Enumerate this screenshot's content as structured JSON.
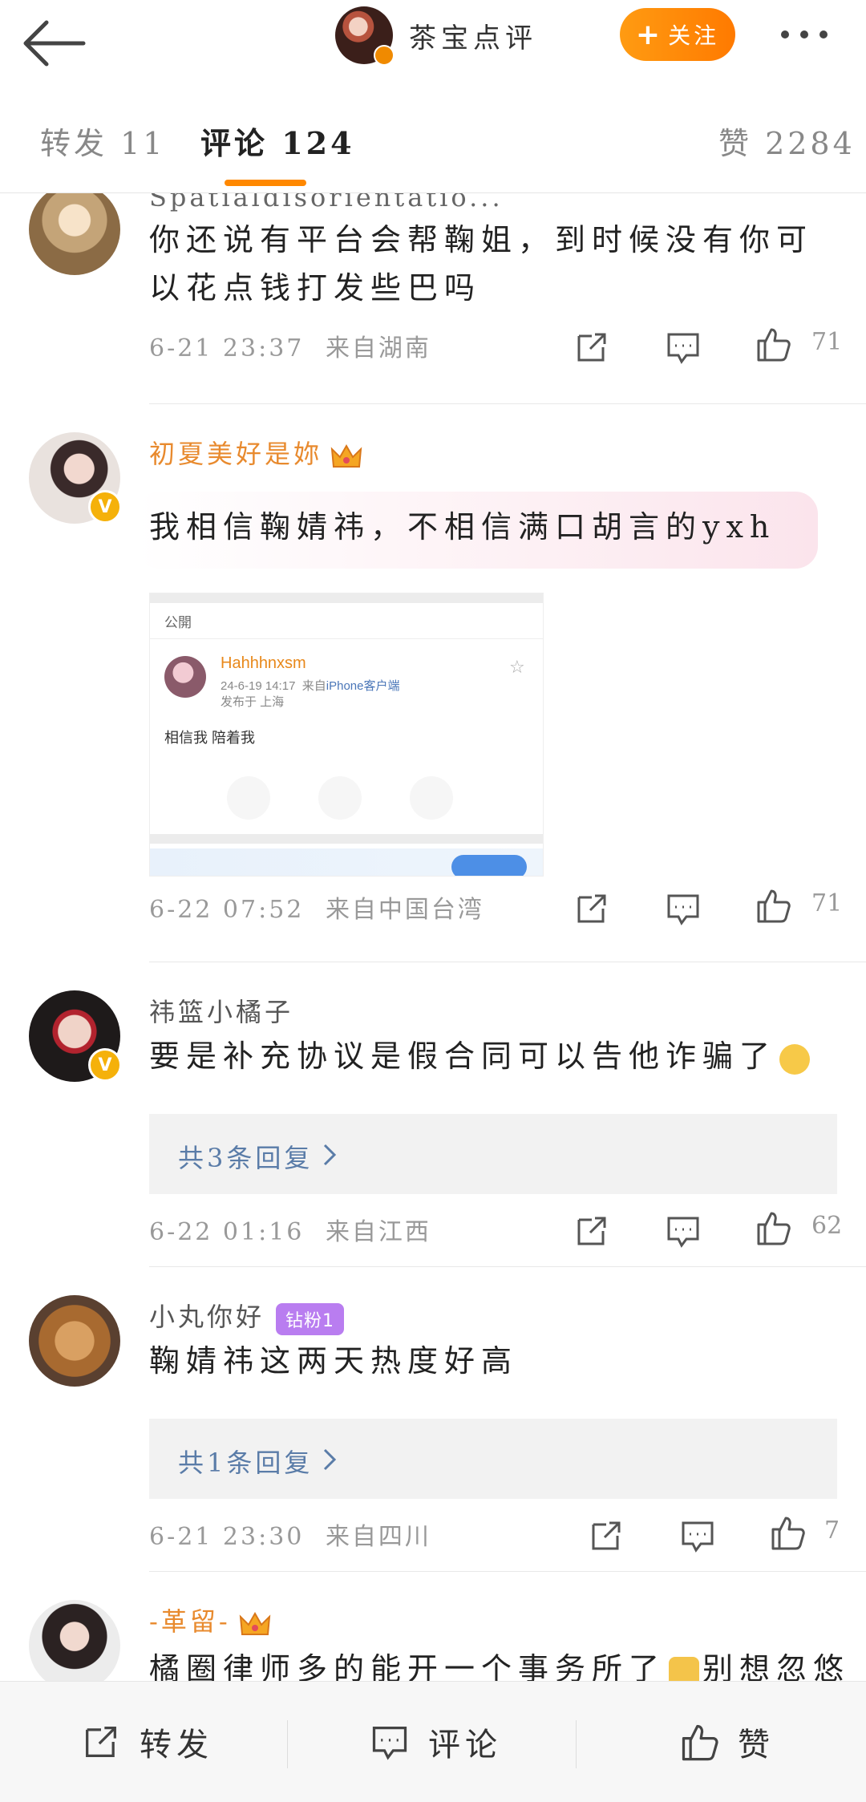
{
  "header": {
    "title": "茶宝点评",
    "follow_label": "关注"
  },
  "tabs": [
    {
      "label": "转发 11"
    },
    {
      "label": "评论 124"
    },
    {
      "label": "赞 2284"
    }
  ],
  "comments": [
    {
      "username": "Spatialdisorientatio...",
      "text": "你还说有平台会帮鞠姐，到时候没有你可以花点钱打发些巴吗",
      "time": "6-21 23:37",
      "location": "来自湖南",
      "likes": "71"
    },
    {
      "username": "初夏美好是妳",
      "text": "我相信鞠婧祎，不相信满口胡言的yxh",
      "time": "6-22 07:52",
      "location": "来自中国台湾",
      "likes": "71",
      "screenshot": {
        "visibility": "公開",
        "name": "Hahhhnxsm",
        "date": "24-6-19 14:17",
        "via_prefix": "来自",
        "via": "iPhone客户端",
        "published": "发布于 上海",
        "body": "相信我 陪着我"
      }
    },
    {
      "username": "祎篮小橘子",
      "text": "要是补充协议是假合同可以告他诈骗了",
      "replies": "共3条回复",
      "time": "6-22 01:16",
      "location": "来自江西",
      "likes": "62"
    },
    {
      "username": "小丸你好",
      "badge": "钻粉1",
      "text": "鞠婧祎这两天热度好高",
      "replies": "共1条回复",
      "time": "6-21 23:30",
      "location": "来自四川",
      "likes": "7"
    },
    {
      "username": "-革留-",
      "text": "橘圈律师多的能开一个事务所了",
      "text_tail": "别想忽悠"
    }
  ],
  "bottom_bar": {
    "repost": "转发",
    "comment": "评论",
    "like": "赞"
  },
  "colors": {
    "accent": "#ff8800",
    "reply_link": "#5a7ca8",
    "vip_name": "#e88a2e"
  }
}
